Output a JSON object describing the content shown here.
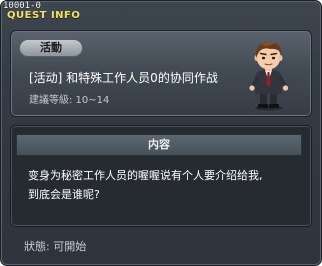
{
  "window": {
    "quest_id": "10001-0",
    "title": "QUEST INFO"
  },
  "summary": {
    "tag": "活動",
    "name": "[活动] 和特殊工作人员0的协同作战",
    "recommended_level": "建議等級: 10~14",
    "npc_icon": "npc-businessman-portrait"
  },
  "details": {
    "header": "内容",
    "lines": [
      "变身为秘密工作人员的喔喔说有个人要介绍给我,",
      "到底会是谁呢?"
    ]
  },
  "status": {
    "text": "狀態: 可開始"
  },
  "colors": {
    "title_yellow": "#f1e25f",
    "panel_dark": "#262b31",
    "panel_light": "#5b646e"
  }
}
